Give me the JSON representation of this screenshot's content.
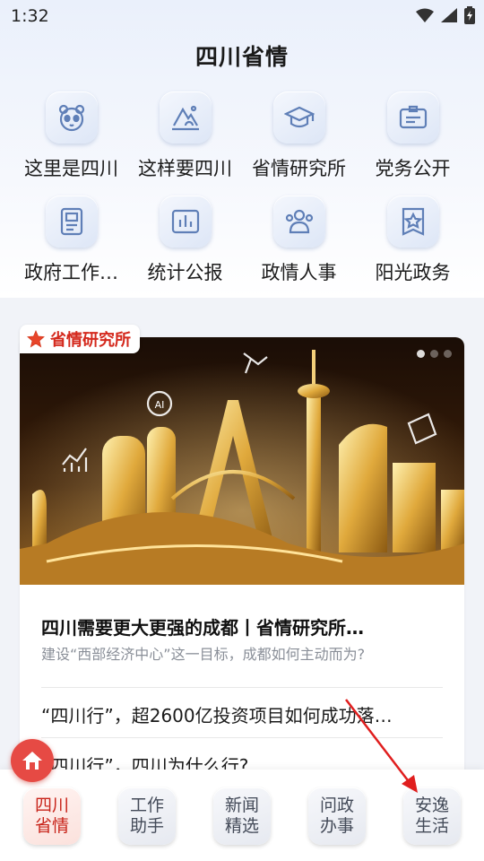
{
  "status": {
    "time": "1:32"
  },
  "header": {
    "title": "四川省情"
  },
  "grid": [
    {
      "label": "这里是四川",
      "icon": "panda-icon"
    },
    {
      "label": "这样要四川",
      "icon": "mountain-icon"
    },
    {
      "label": "省情研究所",
      "icon": "graduation-cap-icon"
    },
    {
      "label": "党务公开",
      "icon": "id-card-icon"
    },
    {
      "label": "政府工作…",
      "icon": "document-icon"
    },
    {
      "label": "统计公报",
      "icon": "bar-chart-icon"
    },
    {
      "label": "政情人事",
      "icon": "people-icon"
    },
    {
      "label": "阳光政务",
      "icon": "star-badge-icon"
    }
  ],
  "card": {
    "tag": "省情研究所",
    "headline": "四川需要更大更强的成都丨省情研究所…",
    "subtitle": "建设“西部经济中心”这一目标，成都如何主动而为?",
    "items": [
      "“四川行”，超2600亿投资项目如何成功落…",
      "“四川行”，四川为什么行?"
    ]
  },
  "tabs": [
    {
      "line1": "四川",
      "line2": "省情",
      "active": true
    },
    {
      "line1": "工作",
      "line2": "助手",
      "active": false
    },
    {
      "line1": "新闻",
      "line2": "精选",
      "active": false
    },
    {
      "line1": "问政",
      "line2": "办事",
      "active": false
    },
    {
      "line1": "安逸",
      "line2": "生活",
      "active": false
    }
  ],
  "colors": {
    "accent": "#d4281c",
    "icon_stroke": "#5f7fb7",
    "annotation": "#e01e1e"
  }
}
